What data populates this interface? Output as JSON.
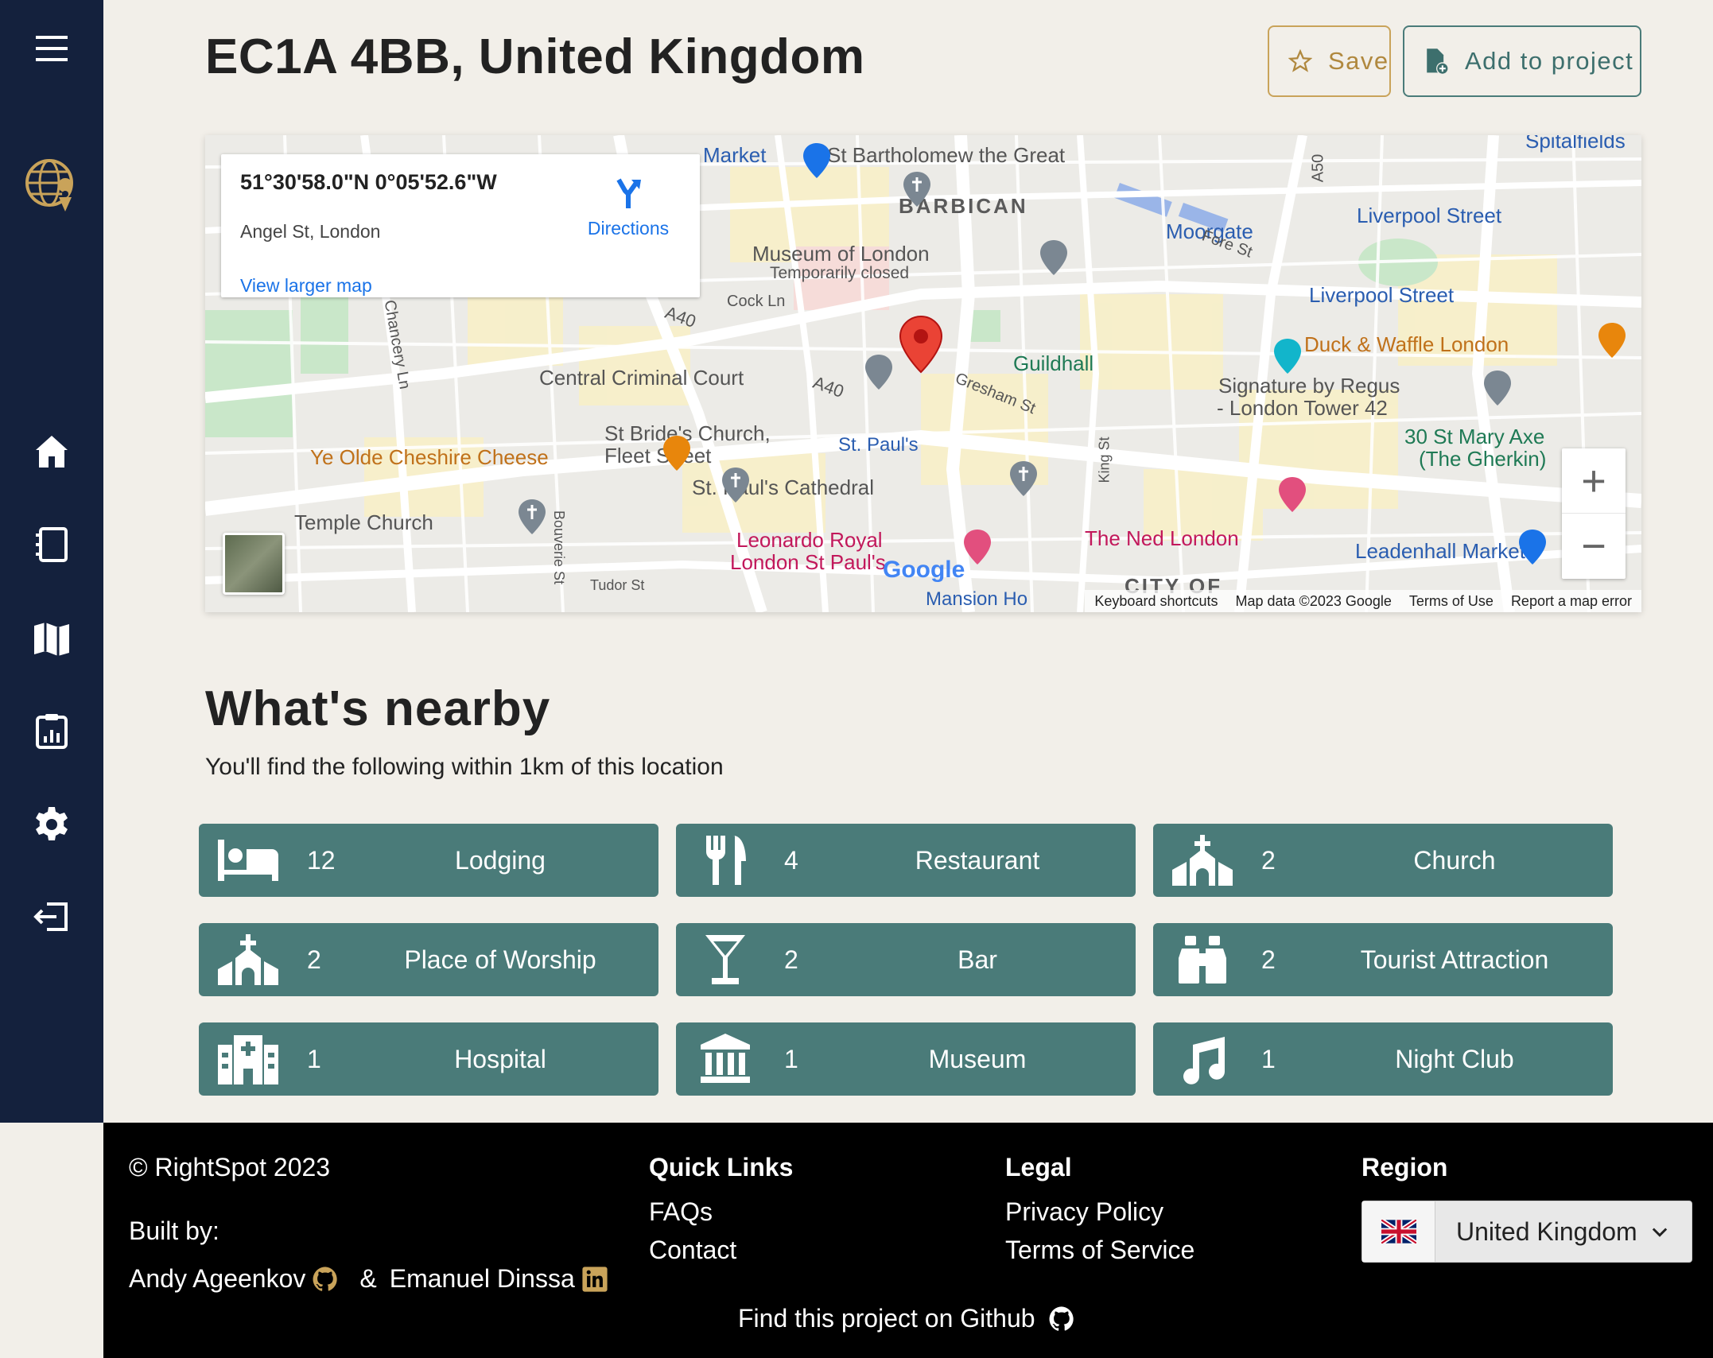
{
  "page": {
    "title": "EC1A 4BB, United Kingdom",
    "save_label": "Save",
    "add_project_label": "Add to project"
  },
  "sidebar": {
    "icons": [
      "menu-icon",
      "globe-logo-icon",
      "home-icon",
      "notebook-icon",
      "map-icon",
      "report-icon",
      "gear-icon",
      "logout-icon"
    ]
  },
  "map": {
    "coords": "51°30'58.0\"N 0°05'52.6\"W",
    "address": "Angel St, London",
    "directions_label": "Directions",
    "larger_map_label": "View larger map",
    "labels": {
      "market": "Market",
      "st_bart": "St Bartholomew the Great",
      "barbican": "BARBICAN",
      "moorgate": "Moorgate",
      "liverpool1": "Liverpool Street",
      "liverpool2": "Liverpool Street",
      "museum": "Museum of London",
      "museum_closed": "Temporarily closed",
      "cock_ln": "Cock Ln",
      "a40a": "A40",
      "a40b": "A40",
      "guildhall": "Guildhall",
      "duck": "Duck & Waffle London",
      "central": "Central Criminal Court",
      "signature1": "Signature by Regus",
      "signature2": "- London Tower 42",
      "gresham": "Gresham St",
      "chancery": "Chancery Ln",
      "st_brides1": "St Bride's Church,",
      "st_brides2": "Fleet Street",
      "st_pauls_tube": "St. Paul's",
      "mary_axe1": "30 St Mary Axe",
      "mary_axe2": "(The Gherkin)",
      "cheshire": "Ye Olde Cheshire Cheese",
      "cathedral": "St. Paul's Cathedral",
      "king_st": "King St",
      "temple": "Temple Church",
      "ned": "The Ned London",
      "leadenhall": "Leadenhall Market",
      "leonardo1": "Leonardo Royal",
      "leonardo2": "London St Paul's",
      "bouverie": "Bouverie St",
      "tudor": "Tudor St",
      "city_of": "CITY OF",
      "mansion": "Mansion Ho",
      "fore_st": "Fore St",
      "a50": "A50",
      "spitalfields": "Spitalfields",
      "google": "Google"
    },
    "attribution": {
      "shortcuts": "Keyboard shortcuts",
      "data": "Map data ©2023 Google",
      "terms": "Terms of Use",
      "report": "Report a map error"
    },
    "zoom_in": "+",
    "zoom_out": "−"
  },
  "nearby": {
    "title": "What's nearby",
    "subtitle": "You'll find the following within 1km of this location",
    "items": [
      {
        "count": "12",
        "label": "Lodging",
        "icon": "bed-icon"
      },
      {
        "count": "4",
        "label": "Restaurant",
        "icon": "utensils-icon"
      },
      {
        "count": "2",
        "label": "Church",
        "icon": "church-icon"
      },
      {
        "count": "2",
        "label": "Place of Worship",
        "icon": "church-icon"
      },
      {
        "count": "2",
        "label": "Bar",
        "icon": "cocktail-icon"
      },
      {
        "count": "2",
        "label": "Tourist Attraction",
        "icon": "binoculars-icon"
      },
      {
        "count": "1",
        "label": "Hospital",
        "icon": "hospital-icon"
      },
      {
        "count": "1",
        "label": "Museum",
        "icon": "museum-icon"
      },
      {
        "count": "1",
        "label": "Night Club",
        "icon": "music-icon"
      }
    ]
  },
  "footer": {
    "copyright": "© RightSpot 2023",
    "built_by": "Built by:",
    "author1": "Andy Ageenkov",
    "amp": "&",
    "author2": "Emanuel Dinssa",
    "quick_links_title": "Quick Links",
    "faqs": "FAQs",
    "contact": "Contact",
    "legal_title": "Legal",
    "privacy": "Privacy Policy",
    "terms": "Terms of Service",
    "region_title": "Region",
    "region_value": "United Kingdom",
    "github_text": "Find this project on Github"
  },
  "colors": {
    "sidebar": "#14213d",
    "accent_teal": "#4a7b79",
    "accent_gold": "#c9a35a",
    "background": "#f2efe9"
  }
}
